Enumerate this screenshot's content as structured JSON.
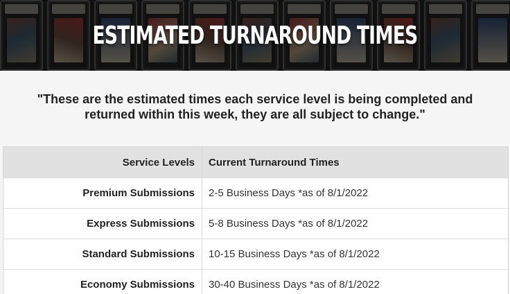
{
  "hero": {
    "title": "ESTIMATED TURNAROUND TIMES"
  },
  "quote": "\"These are the estimated times each service level is being completed and returned within this week, they are all subject to change.\"",
  "table": {
    "headers": [
      "Service Levels",
      "Current Turnaround Times"
    ],
    "rows": [
      {
        "level": "Premium Submissions",
        "time": "2-5 Business Days *as of 8/1/2022"
      },
      {
        "level": "Express Submissions",
        "time": "5-8 Business Days *as of 8/1/2022"
      },
      {
        "level": "Standard Submissions",
        "time": "10-15 Business Days *as of 8/1/2022"
      },
      {
        "level": "Economy Submissions",
        "time": "30-40 Business Days *as of 8/1/2022"
      }
    ]
  },
  "colors": {
    "page_background": "#f5f5f5",
    "table_header_background": "#e1e1e1",
    "hero_text": "#ffffff"
  }
}
